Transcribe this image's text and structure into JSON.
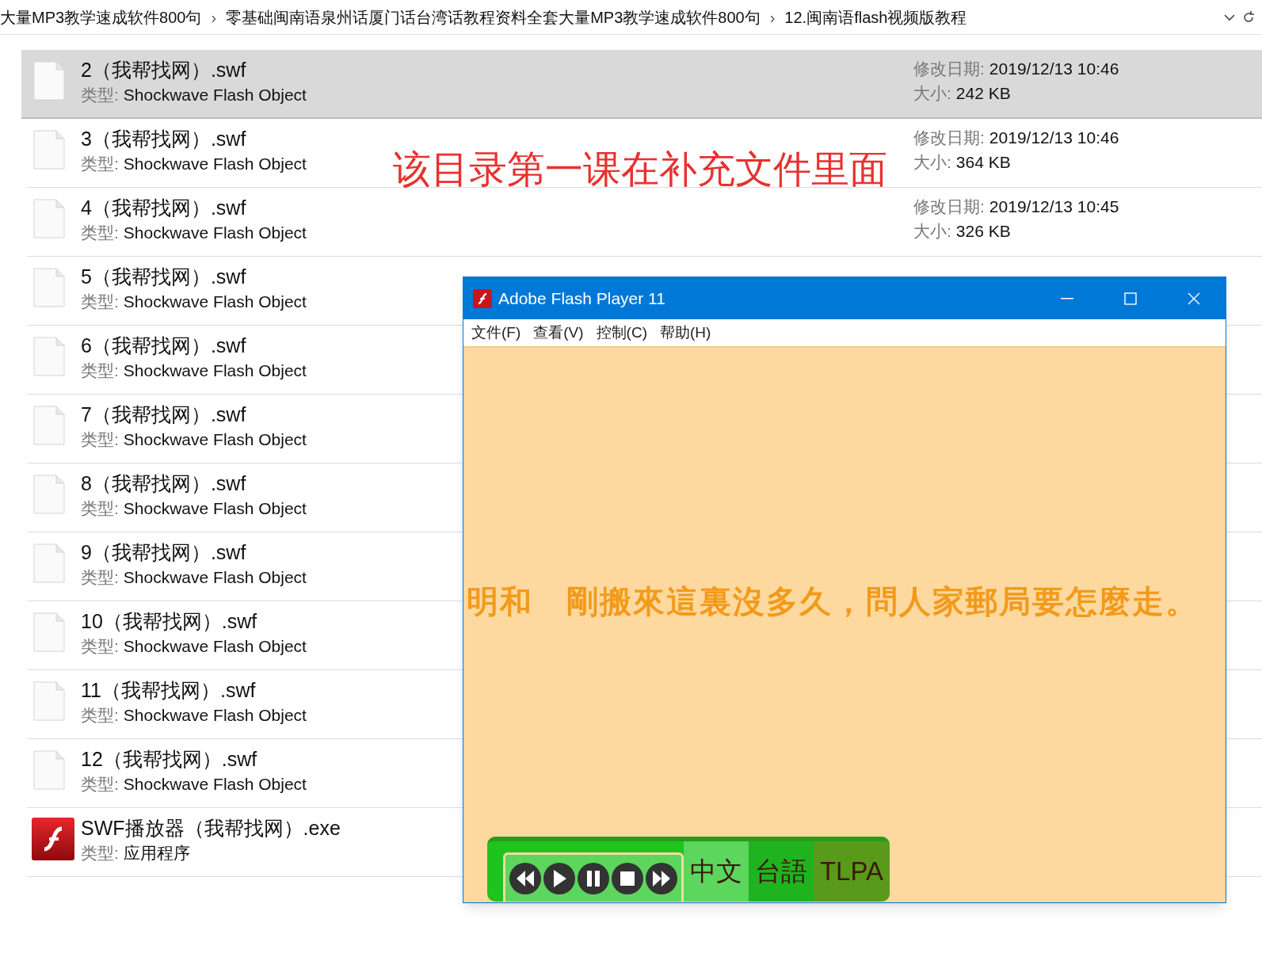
{
  "breadcrumb": {
    "segments": [
      "大量MP3教学速成软件800句",
      "零基础闽南语泉州话厦门话台湾话教程资料全套大量MP3教学速成软件800句",
      "12.闽南语flash视频版教程"
    ],
    "separator": "›"
  },
  "files": [
    {
      "kind": "swf",
      "name": "2（我帮找网）.swf",
      "type_label": "类型:",
      "type": "Shockwave Flash Object",
      "selected": true,
      "details": {
        "date_label": "修改日期:",
        "date": "2019/12/13 10:46",
        "size_label": "大小:",
        "size": "242 KB"
      }
    },
    {
      "kind": "swf",
      "name": "3（我帮找网）.swf",
      "type_label": "类型:",
      "type": "Shockwave Flash Object",
      "selected": false,
      "details": {
        "date_label": "修改日期:",
        "date": "2019/12/13 10:46",
        "size_label": "大小:",
        "size": "364 KB"
      }
    },
    {
      "kind": "swf",
      "name": "4（我帮找网）.swf",
      "type_label": "类型:",
      "type": "Shockwave Flash Object",
      "selected": false,
      "details": {
        "date_label": "修改日期:",
        "date": "2019/12/13 10:45",
        "size_label": "大小:",
        "size": "326 KB"
      }
    },
    {
      "kind": "swf",
      "name": "5（我帮找网）.swf",
      "type_label": "类型:",
      "type": "Shockwave Flash Object",
      "selected": false
    },
    {
      "kind": "swf",
      "name": "6（我帮找网）.swf",
      "type_label": "类型:",
      "type": "Shockwave Flash Object",
      "selected": false
    },
    {
      "kind": "swf",
      "name": "7（我帮找网）.swf",
      "type_label": "类型:",
      "type": "Shockwave Flash Object",
      "selected": false
    },
    {
      "kind": "swf",
      "name": "8（我帮找网）.swf",
      "type_label": "类型:",
      "type": "Shockwave Flash Object",
      "selected": false
    },
    {
      "kind": "swf",
      "name": "9（我帮找网）.swf",
      "type_label": "类型:",
      "type": "Shockwave Flash Object",
      "selected": false
    },
    {
      "kind": "swf",
      "name": "10（我帮找网）.swf",
      "type_label": "类型:",
      "type": "Shockwave Flash Object",
      "selected": false
    },
    {
      "kind": "swf",
      "name": "11（我帮找网）.swf",
      "type_label": "类型:",
      "type": "Shockwave Flash Object",
      "selected": false
    },
    {
      "kind": "swf",
      "name": "12（我帮找网）.swf",
      "type_label": "类型:",
      "type": "Shockwave Flash Object",
      "selected": false
    },
    {
      "kind": "exe",
      "name": "SWF播放器（我帮找网）.exe",
      "type_label": "类型:",
      "type": "应用程序",
      "selected": false
    }
  ],
  "annotation": "该目录第一课在补充文件里面",
  "flash_window": {
    "title": "Adobe Flash Player 11",
    "menu": [
      "文件(F)",
      "查看(V)",
      "控制(C)",
      "帮助(H)"
    ],
    "subtitle": "明和　剛搬來這裏沒多久，問人家郵局要怎麼走。",
    "languages": [
      {
        "label": "中文",
        "color": "#5cd65c"
      },
      {
        "label": "台語",
        "color": "#1fb41f"
      },
      {
        "label": "TLPA",
        "color": "#5a9a1a"
      }
    ]
  }
}
